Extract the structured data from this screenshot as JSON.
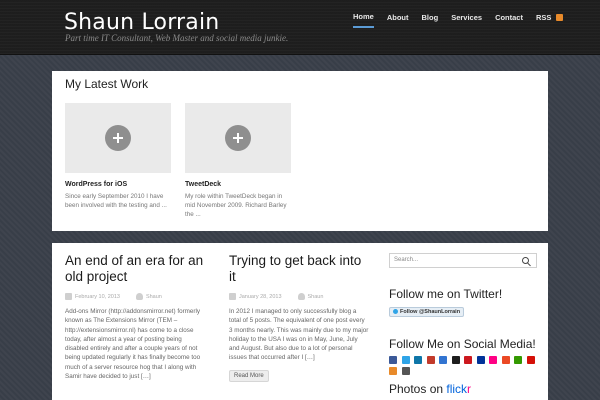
{
  "header": {
    "site_title": "Shaun Lorrain",
    "tagline": "Part time IT Consultant, Web Master and social media junkie.",
    "nav": [
      "Home",
      "About",
      "Blog",
      "Services",
      "Contact",
      "RSS"
    ]
  },
  "latest_work": {
    "heading": "My Latest Work",
    "items": [
      {
        "title": "WordPress for iOS",
        "excerpt": "Since early September 2010 I have been involved with the testing and ..."
      },
      {
        "title": "TweetDeck",
        "excerpt": "My role within TweetDeck began in mid November 2009. Richard Barley the ..."
      }
    ]
  },
  "posts": [
    {
      "title": "An end of an era for an old project",
      "date": "February 10, 2013",
      "author": "Shaun",
      "excerpt": "Add-ons Mirror (http://addonsmirror.net) formerly known as The Extensions Mirror (TEM – http://extensionsmirror.nl) has come to a close today, after almost a year of posting being disabled entirely and after a couple years of not being updated regularly it has finally become too much of a server resource hog that I along with Samir have decided to just […]"
    },
    {
      "title": "Trying to get back into it",
      "date": "January 28, 2013",
      "author": "Shaun",
      "excerpt": "In 2012 I managed to only successfully blog a total of 5 posts. The equivalent of one post every 3 months nearly. This was mainly due to my major holiday to the USA I was on in May, June, July and August. But also due to a lot of personal issues that occurred after I […]",
      "read_more": "Read More"
    }
  ],
  "sidebar": {
    "search_placeholder": "Search...",
    "twitter_title": "Follow me on Twitter!",
    "follow_button": "Follow @ShaunLorrain",
    "social_title": "Follow Me on Social Media!",
    "social_icons": [
      {
        "name": "facebook-icon",
        "color": "#3b5998"
      },
      {
        "name": "twitter-icon",
        "color": "#2fa4e7"
      },
      {
        "name": "linkedin-icon",
        "color": "#0e76a8"
      },
      {
        "name": "google-icon",
        "color": "#c23a2b"
      },
      {
        "name": "delicious-icon",
        "color": "#3274d1"
      },
      {
        "name": "digg-icon",
        "color": "#1d1d1d"
      },
      {
        "name": "youtube-icon",
        "color": "#cc181e"
      },
      {
        "name": "myspace-icon",
        "color": "#003399"
      },
      {
        "name": "flickr-icon",
        "color": "#ff0084"
      },
      {
        "name": "stumbleupon-icon",
        "color": "#eb4924"
      },
      {
        "name": "technorati-icon",
        "color": "#339900"
      },
      {
        "name": "lastfm-icon",
        "color": "#d51007"
      },
      {
        "name": "rss-icon",
        "color": "#e88a2a"
      },
      {
        "name": "email-icon",
        "color": "#555555"
      }
    ],
    "flickr_prefix": "Photos on ",
    "flickr_brand_blue": "flick",
    "flickr_brand_pink": "r"
  },
  "colors": {
    "accent": "#5b9bd5",
    "header_bg": "#1f1f1f",
    "page_bg": "#3a404a"
  }
}
